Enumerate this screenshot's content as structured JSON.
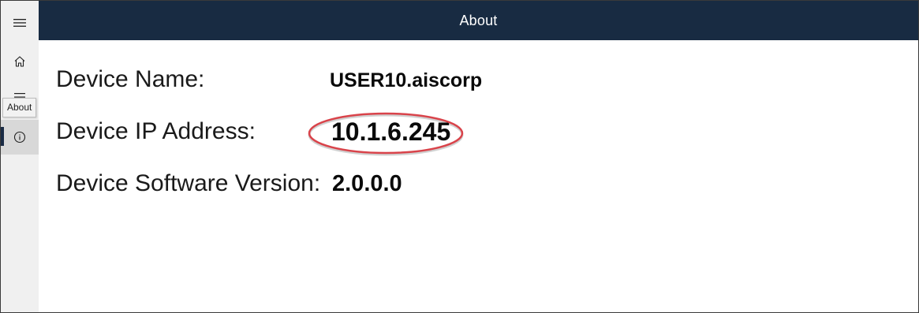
{
  "window": {
    "title": "About"
  },
  "nav": {
    "items": [
      {
        "icon": "hamburger-menu-icon"
      },
      {
        "icon": "home-icon"
      },
      {
        "icon": "list-icon"
      },
      {
        "icon": "info-icon",
        "selected": true
      }
    ],
    "tooltip": "About"
  },
  "device": {
    "name_label": "Device Name:",
    "name_value": "USER10.aiscorp",
    "ip_label": "Device IP Address:",
    "ip_value": "10.1.6.245",
    "version_label": "Device Software Version:",
    "version_value": "2.0.0.0"
  },
  "colors": {
    "header_bg": "#182b42",
    "nav_bg": "#f0f0f0",
    "nav_selected_bg": "#d8d8d8",
    "selection_indicator": "#1a2b45",
    "highlight_ellipse": "#d9434a"
  }
}
